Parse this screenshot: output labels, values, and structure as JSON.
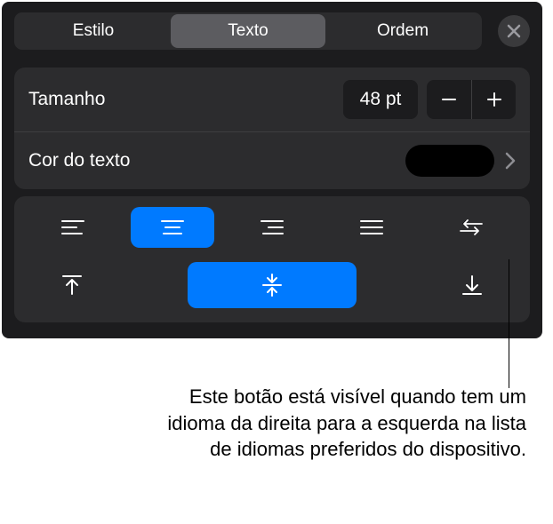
{
  "tabs": {
    "items": [
      "Estilo",
      "Texto",
      "Ordem"
    ],
    "active_index": 1
  },
  "size_row": {
    "label": "Tamanho",
    "value": "48 pt"
  },
  "color_row": {
    "label": "Cor do texto",
    "swatch_hex": "#000000"
  },
  "alignment": {
    "horizontal": [
      "left",
      "center",
      "right",
      "justify",
      "rtl"
    ],
    "horizontal_active": 1,
    "vertical": [
      "top",
      "middle",
      "bottom"
    ],
    "vertical_active": 1
  },
  "callout_text": "Este botão está visível quando tem um idioma da direita para a esquerda na lista de idiomas preferidos do dispositivo."
}
